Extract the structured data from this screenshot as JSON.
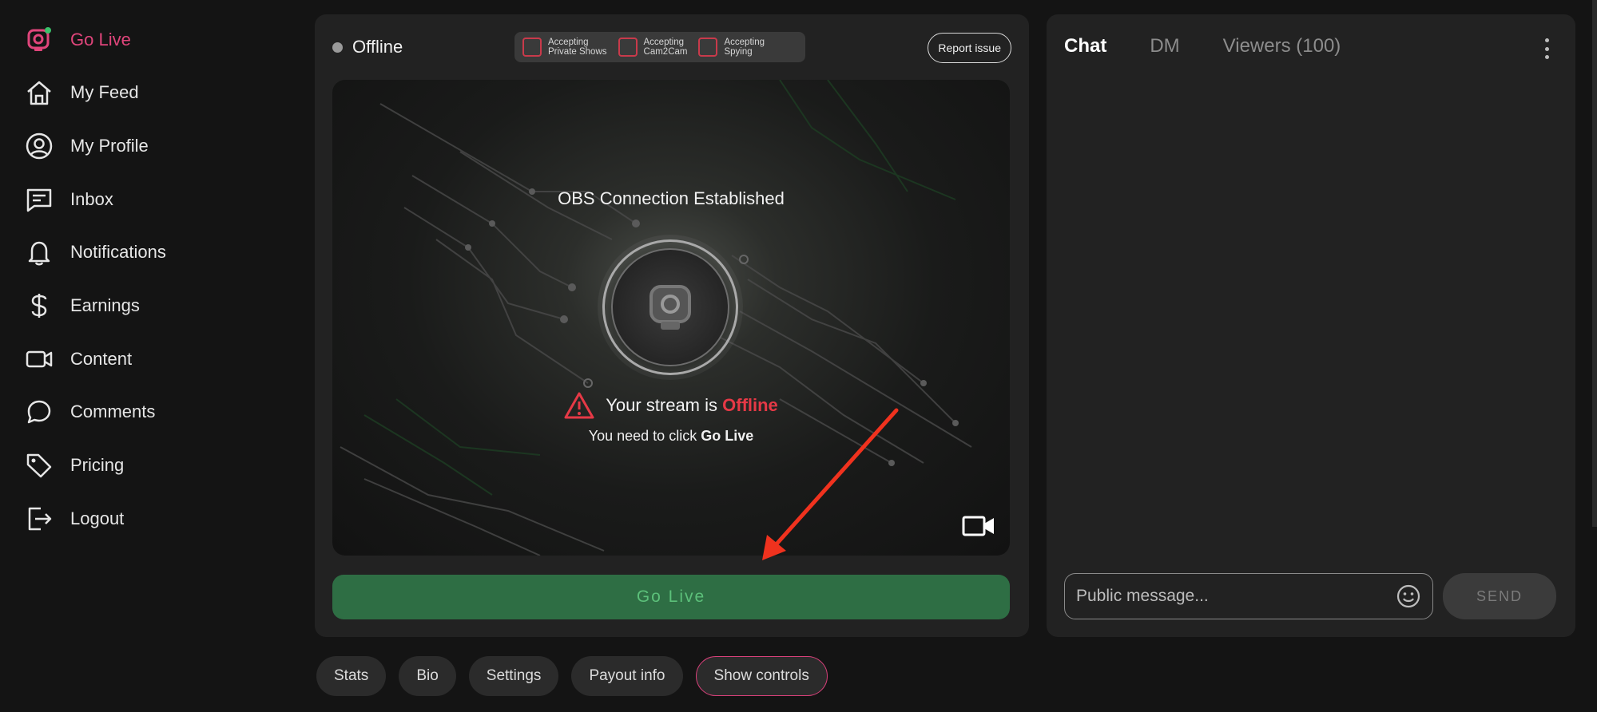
{
  "sidebar": {
    "items": [
      {
        "label": "Go Live",
        "icon": "go-live-icon",
        "active": true
      },
      {
        "label": "My Feed",
        "icon": "home-icon"
      },
      {
        "label": "My Profile",
        "icon": "profile-icon"
      },
      {
        "label": "Inbox",
        "icon": "inbox-icon"
      },
      {
        "label": "Notifications",
        "icon": "bell-icon"
      },
      {
        "label": "Earnings",
        "icon": "dollar-icon"
      },
      {
        "label": "Content",
        "icon": "video-icon"
      },
      {
        "label": "Comments",
        "icon": "comment-icon"
      },
      {
        "label": "Pricing",
        "icon": "tag-icon"
      },
      {
        "label": "Logout",
        "icon": "logout-icon"
      }
    ]
  },
  "stream": {
    "status": "Offline",
    "toggles": [
      {
        "line1": "Accepting",
        "line2": "Private Shows"
      },
      {
        "line1": "Accepting",
        "line2": "Cam2Cam"
      },
      {
        "line1": "Accepting",
        "line2": "Spying"
      }
    ],
    "report_label": "Report issue",
    "obs_text": "OBS Connection Established",
    "msg_prefix": "Your stream is ",
    "msg_status": "Offline",
    "hint_prefix": "You need to click ",
    "hint_bold": "Go Live",
    "go_live_label": "Go Live"
  },
  "chat": {
    "tabs": [
      "Chat",
      "DM",
      "Viewers (100)"
    ],
    "placeholder": "Public message...",
    "send_label": "SEND"
  },
  "bottom_tabs": [
    "Stats",
    "Bio",
    "Settings",
    "Payout info",
    "Show controls"
  ],
  "colors": {
    "accent": "#e0457b",
    "go_live_bg": "#2e6e44",
    "go_live_text": "#5cc07a",
    "offline_red": "#e63946"
  }
}
